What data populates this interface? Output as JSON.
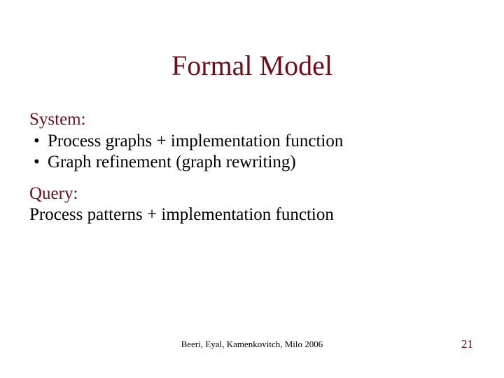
{
  "title": "Formal Model",
  "system": {
    "heading": "System:",
    "bullets": [
      "Process graphs + implementation function",
      "Graph refinement (graph rewriting)"
    ]
  },
  "query": {
    "heading": "Query:",
    "line": "Process patterns + implementation function"
  },
  "footer": {
    "citation": "Beeri, Eyal, Kamenkovitch, Milo  2006",
    "page_number": "21"
  }
}
